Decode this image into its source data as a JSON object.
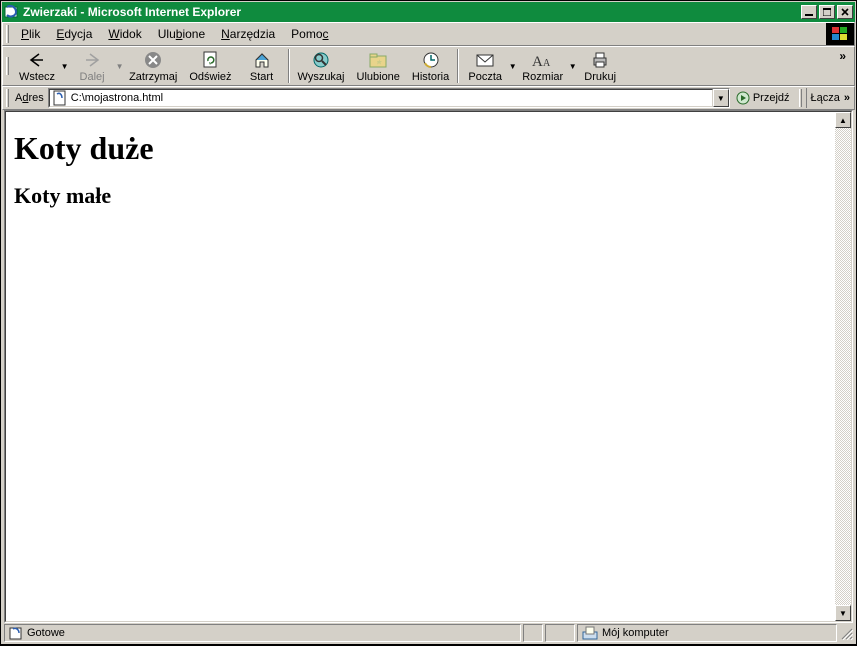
{
  "title": "Zwierzaki - Microsoft Internet Explorer",
  "menu": [
    "Plik",
    "Edycja",
    "Widok",
    "Ulubione",
    "Narzędzia",
    "Pomoc"
  ],
  "menu_underline_idx": [
    0,
    0,
    0,
    3,
    0,
    4
  ],
  "toolbar": {
    "back": "Wstecz",
    "forward": "Dalej",
    "stop": "Zatrzymaj",
    "refresh": "Odśwież",
    "home": "Start",
    "search": "Wyszukaj",
    "favorites": "Ulubione",
    "history": "Historia",
    "mail": "Poczta",
    "size": "Rozmiar",
    "print": "Drukuj"
  },
  "address": {
    "label": "Adres",
    "value": "C:\\mojastrona.html",
    "go": "Przejdź",
    "links": "Łącza"
  },
  "page": {
    "h1": "Koty duże",
    "h2": "Koty małe"
  },
  "status": {
    "ready": "Gotowe",
    "zone": "Mój komputer"
  }
}
